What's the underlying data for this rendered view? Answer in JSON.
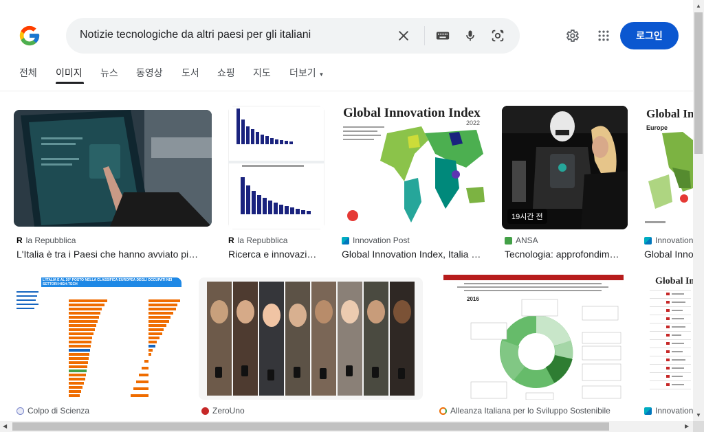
{
  "search": {
    "query": "Notizie tecnologiche da altri paesi per gli italiani"
  },
  "header": {
    "login_label": "로그인"
  },
  "tabs": [
    {
      "label": "전체"
    },
    {
      "label": "이미지"
    },
    {
      "label": "뉴스"
    },
    {
      "label": "동영상"
    },
    {
      "label": "도서"
    },
    {
      "label": "쇼핑"
    },
    {
      "label": "지도"
    },
    {
      "label": "더보기"
    }
  ],
  "results": [
    {
      "source": "la Repubblica",
      "title": "L'Italia è tra i Paesi che hanno avviato pi…"
    },
    {
      "source": "la Repubblica",
      "title": "Ricerca e innovazi…"
    },
    {
      "source": "Innovation Post",
      "title": "Global Innovation Index, Italia …",
      "thumb_title": "Global Innovation Index",
      "thumb_year": "2022"
    },
    {
      "source": "ANSA",
      "title": "Tecnologia: approfondim…",
      "badge": "19시간 전"
    },
    {
      "source": "Innovation",
      "title": "Global Inno",
      "thumb_title": "Global In",
      "thumb_sub": "Europe"
    },
    {
      "source": "Colpo di Scienza",
      "thumb_heading": "L'ITALIA È AL 20° POSTO NELLA CLASSIFICA EUROPEA DEGLI OCCUPATI NEI SETTORI HIGH-TECH"
    },
    {
      "source": "ZeroUno"
    },
    {
      "source": "Alleanza Italiana per lo Sviluppo Sostenibile",
      "thumb_year": "2016"
    },
    {
      "source": "Innovation",
      "thumb_title": "Global In"
    }
  ],
  "colors": {
    "accent": "#0b57d0",
    "chart_bar": "#1a237e",
    "map_green": "#7cb342",
    "orange": "#ef6c00",
    "teal": "#00838f"
  }
}
